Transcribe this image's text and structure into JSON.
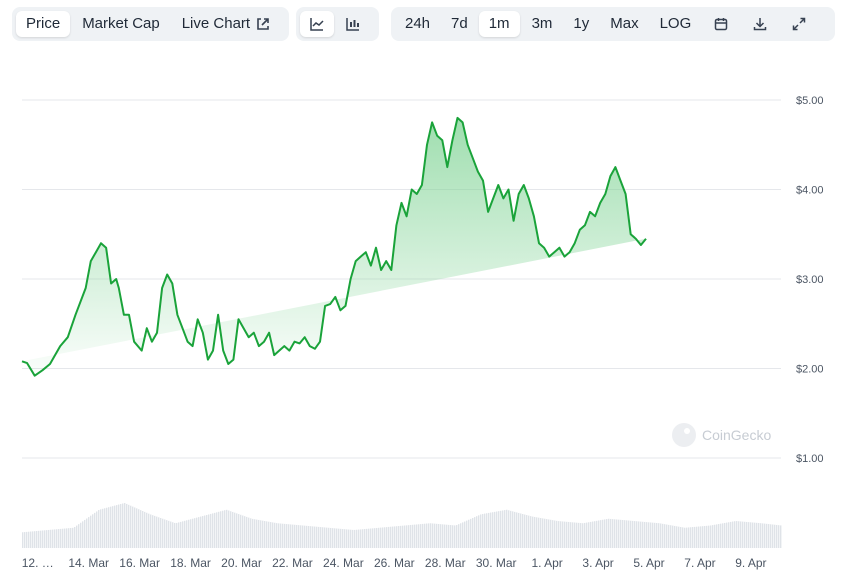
{
  "toolbar": {
    "metric_tabs": [
      {
        "label": "Price",
        "active": true
      },
      {
        "label": "Market Cap",
        "active": false
      },
      {
        "label": "Live Chart",
        "active": false
      }
    ],
    "chart_styles": [
      "line-chart-icon",
      "candlestick-icon"
    ],
    "ranges": [
      {
        "label": "24h",
        "active": false
      },
      {
        "label": "7d",
        "active": false
      },
      {
        "label": "1m",
        "active": true
      },
      {
        "label": "3m",
        "active": false
      },
      {
        "label": "1y",
        "active": false
      },
      {
        "label": "Max",
        "active": false
      },
      {
        "label": "LOG",
        "active": false
      }
    ],
    "actions": [
      "calendar-icon",
      "download-icon",
      "expand-icon"
    ]
  },
  "watermark": "CoinGecko",
  "colors": {
    "line": "#1aa33a",
    "fill_top": "#7fd394",
    "grid": "#e5e7eb",
    "volume": "#dfe3e8"
  },
  "chart_data": {
    "type": "area",
    "title": "",
    "xlabel": "",
    "ylabel": "",
    "ylim": [
      1.0,
      5.0
    ],
    "y_ticks": [
      "$1.00",
      "$2.00",
      "$3.00",
      "$4.00",
      "$5.00"
    ],
    "y_tick_values": [
      1,
      2,
      3,
      4,
      5
    ],
    "x_ticks": [
      "12. …",
      "14. Mar",
      "16. Mar",
      "18. Mar",
      "20. Mar",
      "22. Mar",
      "24. Mar",
      "26. Mar",
      "28. Mar",
      "30. Mar",
      "1. Apr",
      "3. Apr",
      "5. Apr",
      "7. Apr",
      "9. Apr"
    ],
    "x_tick_days": [
      0,
      2,
      4,
      6,
      8,
      10,
      12,
      14,
      16,
      18,
      20,
      22,
      24,
      26,
      28
    ],
    "xlim_days": [
      -0.5,
      29.3
    ],
    "grid": true,
    "legend": "none",
    "price_series": {
      "name": "",
      "x_days": [
        -0.5,
        -0.3,
        0.0,
        0.3,
        0.6,
        1.0,
        1.3,
        1.6,
        2.0,
        2.2,
        2.4,
        2.6,
        2.8,
        3.0,
        3.2,
        3.3,
        3.5,
        3.7,
        3.9,
        4.2,
        4.4,
        4.6,
        4.8,
        5.0,
        5.2,
        5.4,
        5.6,
        5.8,
        6.0,
        6.2,
        6.4,
        6.6,
        6.8,
        7.0,
        7.2,
        7.4,
        7.6,
        7.8,
        8.0,
        8.2,
        8.4,
        8.6,
        8.8,
        9.0,
        9.2,
        9.4,
        9.6,
        9.8,
        10.0,
        10.2,
        10.4,
        10.6,
        10.8,
        11.0,
        11.2,
        11.4,
        11.6,
        11.8,
        12.0,
        12.2,
        12.4,
        12.6,
        12.8,
        13.0,
        13.2,
        13.4,
        13.6,
        13.8,
        14.0,
        14.2,
        14.4,
        14.6,
        14.8,
        15.0,
        15.2,
        15.4,
        15.6,
        15.8,
        16.0,
        16.2,
        16.4,
        16.6,
        16.8,
        17.0,
        17.2,
        17.4,
        17.6,
        17.8,
        18.0,
        18.2,
        18.4,
        18.6,
        18.8,
        19.0,
        19.2,
        19.4,
        19.6,
        19.8,
        20.0,
        20.2,
        20.4,
        20.6,
        20.8,
        21.0,
        21.2,
        21.4,
        21.6,
        21.8,
        22.0,
        22.2,
        22.4,
        22.6,
        22.8,
        23.0,
        23.2,
        23.4,
        23.6,
        23.8,
        24.0,
        24.2,
        24.4,
        24.6,
        24.8,
        25.0,
        25.2,
        25.4,
        25.6,
        25.8,
        26.0,
        26.2,
        26.4,
        26.6,
        26.8,
        27.0,
        27.2,
        27.4,
        27.6,
        27.8,
        28.0,
        28.2,
        28.4,
        28.6,
        28.8,
        29.0,
        29.2,
        29.3
      ],
      "values": [
        2.08,
        2.06,
        1.92,
        1.98,
        2.05,
        2.25,
        2.35,
        2.6,
        2.9,
        3.2,
        3.3,
        3.4,
        3.35,
        2.95,
        3.0,
        2.9,
        2.6,
        2.6,
        2.3,
        2.2,
        2.45,
        2.3,
        2.4,
        2.9,
        3.05,
        2.95,
        2.6,
        2.45,
        2.3,
        2.25,
        2.55,
        2.4,
        2.1,
        2.2,
        2.6,
        2.2,
        2.05,
        2.1,
        2.55,
        2.45,
        2.35,
        2.4,
        2.25,
        2.3,
        2.4,
        2.15,
        2.2,
        2.25,
        2.2,
        2.3,
        2.28,
        2.35,
        2.25,
        2.22,
        2.3,
        2.7,
        2.72,
        2.8,
        2.65,
        2.7,
        3.0,
        3.2,
        3.25,
        3.3,
        3.15,
        3.35,
        3.1,
        3.2,
        3.1,
        3.6,
        3.85,
        3.7,
        4.0,
        3.95,
        4.05,
        4.5,
        4.75,
        4.6,
        4.55,
        4.25,
        4.55,
        4.8,
        4.75,
        4.5,
        4.35,
        4.2,
        4.1,
        3.75,
        3.9,
        4.05,
        3.9,
        4.0,
        3.65,
        3.95,
        4.05,
        3.9,
        3.7,
        3.4,
        3.35,
        3.25,
        3.3,
        3.35,
        3.25,
        3.3,
        3.4,
        3.55,
        3.6,
        3.75,
        3.7,
        3.85,
        3.95,
        4.15,
        4.25,
        4.1,
        3.95,
        3.5,
        3.45,
        3.38,
        3.45
      ]
    },
    "volume_series": {
      "name": "",
      "x_days": [
        -0.5,
        0.5,
        1.5,
        2.5,
        3.5,
        4.5,
        5.5,
        6.5,
        7.5,
        8.5,
        9.5,
        10.5,
        11.5,
        12.5,
        13.5,
        14.5,
        15.5,
        16.5,
        17.5,
        18.5,
        19.5,
        20.5,
        21.5,
        22.5,
        23.5,
        24.5,
        25.5,
        26.5,
        27.5,
        28.5,
        29.3
      ],
      "values": [
        0.35,
        0.4,
        0.45,
        0.85,
        1.0,
        0.75,
        0.55,
        0.7,
        0.85,
        0.65,
        0.55,
        0.5,
        0.45,
        0.4,
        0.45,
        0.5,
        0.55,
        0.5,
        0.75,
        0.85,
        0.7,
        0.6,
        0.55,
        0.65,
        0.6,
        0.55,
        0.45,
        0.5,
        0.6,
        0.55,
        0.5
      ]
    }
  }
}
